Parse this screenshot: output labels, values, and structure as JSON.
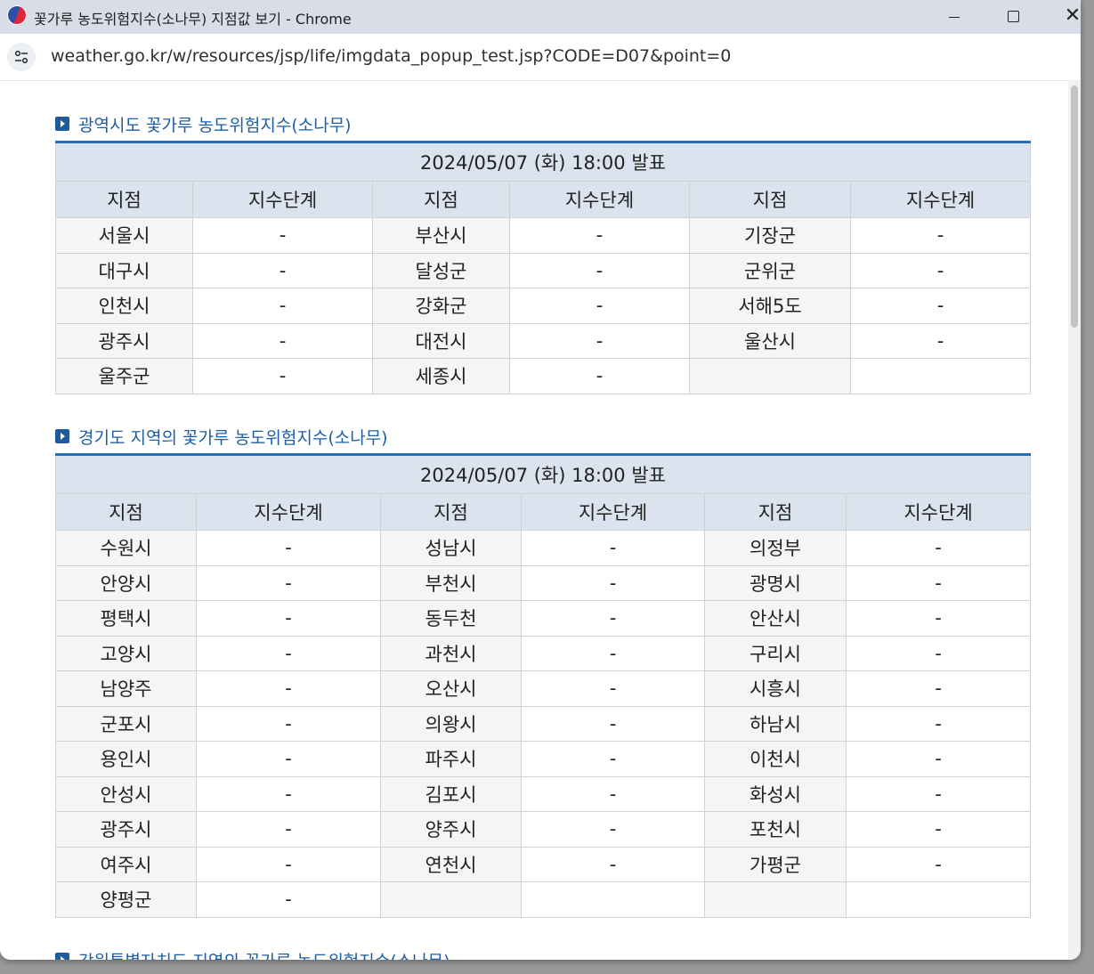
{
  "window": {
    "title": "꽃가루 농도위험지수(소나무) 지점값 보기 - Chrome",
    "url": "weather.go.kr/w/resources/jsp/life/imgdata_popup_test.jsp?CODE=D07&point=0"
  },
  "sections": [
    {
      "title": "광역시도 꽃가루 농도위험지수(소나무)",
      "announcement": "2024/05/07 (화) 18:00 발표",
      "headers": [
        "지점",
        "지수단계",
        "지점",
        "지수단계",
        "지점",
        "지수단계"
      ],
      "rows": [
        [
          "서울시",
          "-",
          "부산시",
          "-",
          "기장군",
          "-"
        ],
        [
          "대구시",
          "-",
          "달성군",
          "-",
          "군위군",
          "-"
        ],
        [
          "인천시",
          "-",
          "강화군",
          "-",
          "서해5도",
          "-"
        ],
        [
          "광주시",
          "-",
          "대전시",
          "-",
          "울산시",
          "-"
        ],
        [
          "울주군",
          "-",
          "세종시",
          "-",
          "",
          ""
        ]
      ]
    },
    {
      "title": "경기도 지역의 꽃가루 농도위험지수(소나무)",
      "announcement": "2024/05/07 (화) 18:00 발표",
      "headers": [
        "지점",
        "지수단계",
        "지점",
        "지수단계",
        "지점",
        "지수단계"
      ],
      "rows": [
        [
          "수원시",
          "-",
          "성남시",
          "-",
          "의정부",
          "-"
        ],
        [
          "안양시",
          "-",
          "부천시",
          "-",
          "광명시",
          "-"
        ],
        [
          "평택시",
          "-",
          "동두천",
          "-",
          "안산시",
          "-"
        ],
        [
          "고양시",
          "-",
          "과천시",
          "-",
          "구리시",
          "-"
        ],
        [
          "남양주",
          "-",
          "오산시",
          "-",
          "시흥시",
          "-"
        ],
        [
          "군포시",
          "-",
          "의왕시",
          "-",
          "하남시",
          "-"
        ],
        [
          "용인시",
          "-",
          "파주시",
          "-",
          "이천시",
          "-"
        ],
        [
          "안성시",
          "-",
          "김포시",
          "-",
          "화성시",
          "-"
        ],
        [
          "광주시",
          "-",
          "양주시",
          "-",
          "포천시",
          "-"
        ],
        [
          "여주시",
          "-",
          "연천시",
          "-",
          "가평군",
          "-"
        ],
        [
          "양평군",
          "-",
          "",
          "",
          "",
          ""
        ]
      ]
    },
    {
      "title": "강원특별자치도 지역의 꽃가루 농도위험지수(소나무)"
    }
  ]
}
